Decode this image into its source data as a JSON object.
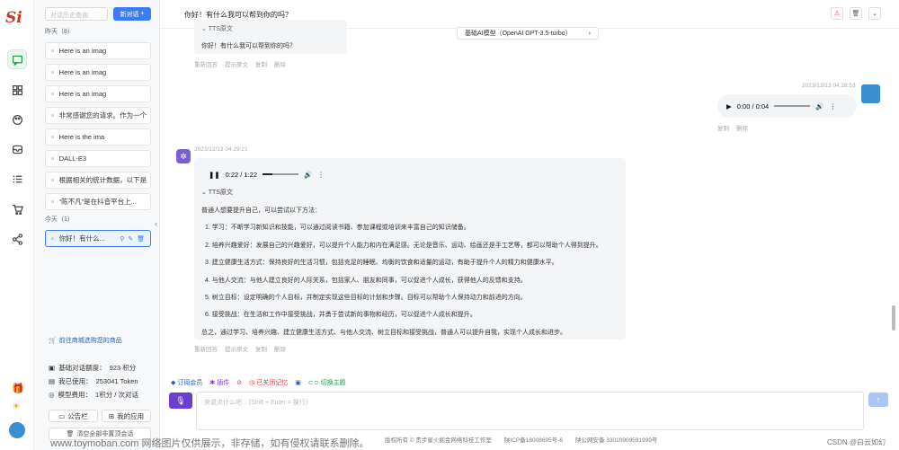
{
  "app": {
    "logo_text": "Si"
  },
  "rail": {
    "icons": [
      "chat-icon",
      "grid-icon",
      "palette-icon",
      "inbox-icon",
      "list-icon",
      "cart-icon",
      "share-icon"
    ]
  },
  "history": {
    "search_placeholder": "对话历史查询",
    "new_chat_label": "新对话",
    "group_yesterday": "昨天（8）",
    "group_today": "今天（1）",
    "items": [
      "Here is an imag",
      "Here is an imag",
      "Here is an imag",
      "非常感谢您的请求。作为一个",
      "Here is the ima",
      "DALL-E3",
      "根据相关的统计数据，以下是",
      "“陈不凡”是在抖音平台上..."
    ],
    "today_items": [
      "你好！有什么..."
    ],
    "store_link": "前往商城选购您的商品",
    "stats": [
      {
        "label": "基础对话额度：",
        "value": "923 积分"
      },
      {
        "label": "我已使用：",
        "value": "253041 Token"
      },
      {
        "label": "模型费用：",
        "value": "1积分 / 次对话"
      }
    ],
    "notice_label": "公告栏",
    "apps_label": "我的应用",
    "clear_label": "清空全部非置顶会话"
  },
  "header": {
    "title": "你好！有什么我可以帮到你的吗？"
  },
  "chat": {
    "prev_bot": {
      "tts_label": "TTS原文",
      "text": "你好！有什么我可以帮到你的吗？",
      "actions": [
        "重新回答",
        "提示原文",
        "复制",
        "删除"
      ]
    },
    "model_label": "基础AI模型（OpenAI GPT-3.5-turbo）",
    "user_msg": {
      "time": "2023/12/13 04:28:53",
      "audio_time": "0:00 / 0:04",
      "actions": [
        "复制",
        "删除"
      ]
    },
    "bot_msg": {
      "time": "2023/12/13 04:29:21",
      "audio_time": "0:22 / 1:22",
      "tts_label": "TTS原文",
      "lines": [
        "普通人想要提升自己，可以尝试以下方法：",
        "1. 学习：不断学习新知识和技能，可以通过阅读书籍、参加课程或培训来丰富自己的知识储备。",
        "2. 培养兴趣爱好：发展自己的兴趣爱好，可以提升个人能力和内在满足感。无论是音乐、运动、绘画还是手工艺等，都可以帮助个人得到提升。",
        "3. 建立健康生活方式：保持良好的生活习惯，包括充足的睡眠、均衡的饮食和适量的运动，有助于提升个人的精力和健康水平。",
        "4. 与他人交流：与他人建立良好的人际关系，包括家人、朋友和同事，可以促进个人成长，获得他人的反馈和支持。",
        "5. 树立目标：设定明确的个人目标，并制定实现这些目标的计划和步骤。目标可以帮助个人保持动力和前进的方向。",
        "6. 接受挑战：在生活和工作中接受挑战，并勇于尝试新的事物和经历，可以促进个人成长和提升。",
        "总之，通过学习、培养兴趣、建立健康生活方式、与他人交流、树立目标和接受挑战，普通人可以提升自我，实现个人成长和进步。"
      ],
      "actions": [
        "重新回答",
        "提示原文",
        "复制",
        "删除"
      ]
    }
  },
  "toolbar": {
    "items": [
      "订阅会员",
      "插件",
      "",
      "已关闭记忆",
      "",
      "切换主题"
    ]
  },
  "input": {
    "placeholder": "来说点什么吧... (Shift + Enter = 换行)"
  },
  "footer": {
    "copyright": "版权所有 © 贵步星火掘金网络科技工作室",
    "icp": "陕ICP备18008695号-6",
    "police": "陕公网安备 33010909591999号"
  },
  "watermark": {
    "left": "www.toymoban.com 网络图片仅供展示，非存储，如有侵权请联系删除。",
    "right": "CSDN @白云如幻"
  },
  "colors": {
    "accent": "#3b7cf5",
    "brand_green": "#1a9c4d",
    "mic_purple": "#6a3fd0"
  }
}
